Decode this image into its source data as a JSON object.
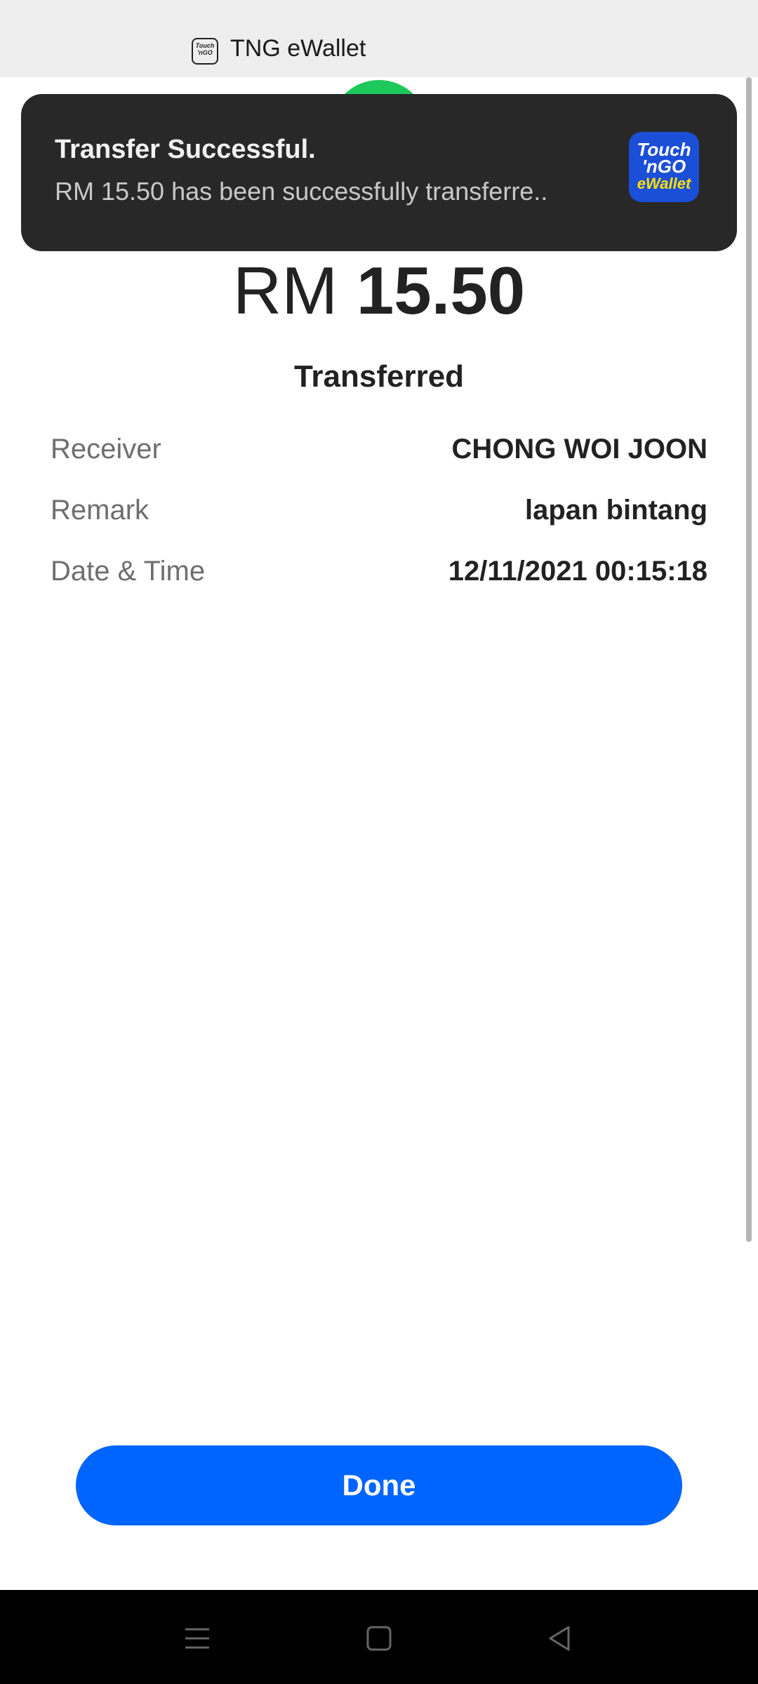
{
  "app_header": {
    "icon": "touch-n-go-icon",
    "icon_text": "Touch 'n GO eWallet",
    "title": "TNG eWallet"
  },
  "toast": {
    "title": "Transfer Successful.",
    "message": "RM 15.50 has been successfully transferre..",
    "logo": {
      "line1": "Touch",
      "line2": "'nGO",
      "line3": "eWallet"
    }
  },
  "amount": {
    "currency": "RM",
    "value": "15.50"
  },
  "status": "Transferred",
  "details": [
    {
      "label": "Receiver",
      "value": "CHONG WOI JOON"
    },
    {
      "label": "Remark",
      "value": "lapan bintang"
    },
    {
      "label": "Date & Time",
      "value": "12/11/2021 00:15:18"
    }
  ],
  "done_label": "Done",
  "colors": {
    "accent": "#0064ff",
    "success": "#1ec85a",
    "toast_bg": "#282828"
  },
  "navigation": [
    "menu-icon",
    "home-icon",
    "back-icon"
  ]
}
